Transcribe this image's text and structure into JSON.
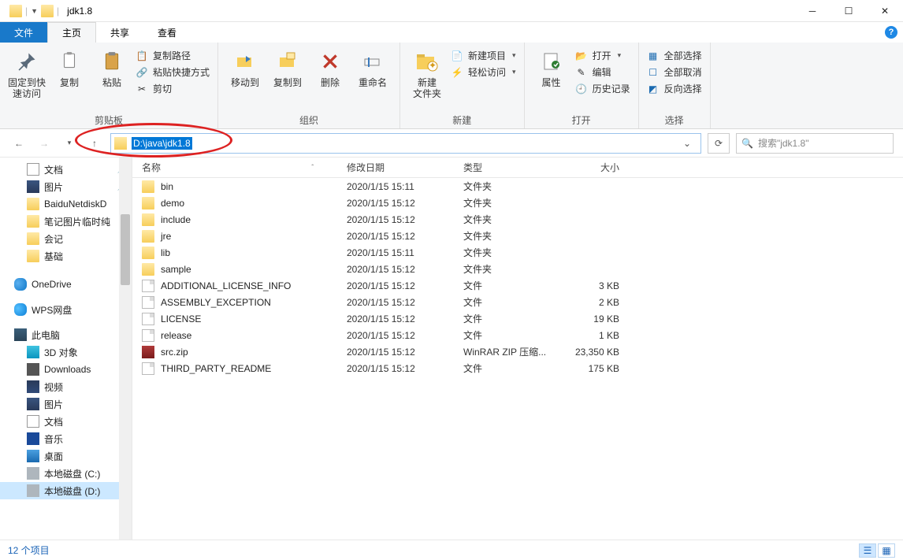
{
  "window": {
    "title": "jdk1.8"
  },
  "tabs": {
    "file": "文件",
    "home": "主页",
    "share": "共享",
    "view": "查看"
  },
  "ribbon": {
    "clipboard": {
      "pin": "固定到快\n速访问",
      "copy": "复制",
      "paste": "粘贴",
      "copy_path": "复制路径",
      "paste_shortcut": "粘贴快捷方式",
      "cut": "剪切",
      "label": "剪贴板"
    },
    "organize": {
      "move_to": "移动到",
      "copy_to": "复制到",
      "delete": "删除",
      "rename": "重命名",
      "label": "组织"
    },
    "new": {
      "new_folder": "新建\n文件夹",
      "new_item": "新建项目",
      "easy_access": "轻松访问",
      "label": "新建"
    },
    "open": {
      "properties": "属性",
      "open": "打开",
      "edit": "编辑",
      "history": "历史记录",
      "label": "打开"
    },
    "select": {
      "select_all": "全部选择",
      "select_none": "全部取消",
      "invert_selection": "反向选择",
      "label": "选择"
    }
  },
  "nav": {
    "path": "D:\\java\\jdk1.8",
    "search_placeholder": "搜索\"jdk1.8\""
  },
  "tree": {
    "items": [
      {
        "label": "文档",
        "ico": "ico-doc",
        "pin": true
      },
      {
        "label": "图片",
        "ico": "ico-pic",
        "pin": true
      },
      {
        "label": "BaiduNetdiskD",
        "ico": "ico-folder"
      },
      {
        "label": "笔记图片临时纯",
        "ico": "ico-folder"
      },
      {
        "label": "会记",
        "ico": "ico-folder"
      },
      {
        "label": "基础",
        "ico": "ico-folder"
      }
    ],
    "onedrive": "OneDrive",
    "wps": "WPS网盘",
    "thispc": "此电脑",
    "pc_children": [
      {
        "label": "3D 对象",
        "ico": "ico-3d"
      },
      {
        "label": "Downloads",
        "ico": "ico-dl"
      },
      {
        "label": "视频",
        "ico": "ico-video"
      },
      {
        "label": "图片",
        "ico": "ico-pic"
      },
      {
        "label": "文档",
        "ico": "ico-doc"
      },
      {
        "label": "音乐",
        "ico": "ico-music"
      },
      {
        "label": "桌面",
        "ico": "ico-desk"
      },
      {
        "label": "本地磁盘 (C:)",
        "ico": "ico-disk"
      },
      {
        "label": "本地磁盘 (D:)",
        "ico": "ico-disk",
        "sel": true
      }
    ]
  },
  "columns": {
    "name": "名称",
    "date": "修改日期",
    "type": "类型",
    "size": "大小"
  },
  "rows": [
    {
      "name": "bin",
      "date": "2020/1/15 15:11",
      "type": "文件夹",
      "size": "",
      "ico": "ico-folder"
    },
    {
      "name": "demo",
      "date": "2020/1/15 15:12",
      "type": "文件夹",
      "size": "",
      "ico": "ico-folder"
    },
    {
      "name": "include",
      "date": "2020/1/15 15:12",
      "type": "文件夹",
      "size": "",
      "ico": "ico-folder"
    },
    {
      "name": "jre",
      "date": "2020/1/15 15:12",
      "type": "文件夹",
      "size": "",
      "ico": "ico-folder"
    },
    {
      "name": "lib",
      "date": "2020/1/15 15:11",
      "type": "文件夹",
      "size": "",
      "ico": "ico-folder"
    },
    {
      "name": "sample",
      "date": "2020/1/15 15:12",
      "type": "文件夹",
      "size": "",
      "ico": "ico-folder"
    },
    {
      "name": "ADDITIONAL_LICENSE_INFO",
      "date": "2020/1/15 15:12",
      "type": "文件",
      "size": "3 KB",
      "ico": "ico-file"
    },
    {
      "name": "ASSEMBLY_EXCEPTION",
      "date": "2020/1/15 15:12",
      "type": "文件",
      "size": "2 KB",
      "ico": "ico-file"
    },
    {
      "name": "LICENSE",
      "date": "2020/1/15 15:12",
      "type": "文件",
      "size": "19 KB",
      "ico": "ico-file"
    },
    {
      "name": "release",
      "date": "2020/1/15 15:12",
      "type": "文件",
      "size": "1 KB",
      "ico": "ico-file"
    },
    {
      "name": "src.zip",
      "date": "2020/1/15 15:12",
      "type": "WinRAR ZIP 压缩...",
      "size": "23,350 KB",
      "ico": "ico-zip"
    },
    {
      "name": "THIRD_PARTY_README",
      "date": "2020/1/15 15:12",
      "type": "文件",
      "size": "175 KB",
      "ico": "ico-file"
    }
  ],
  "status": {
    "count": "12 个项目"
  }
}
